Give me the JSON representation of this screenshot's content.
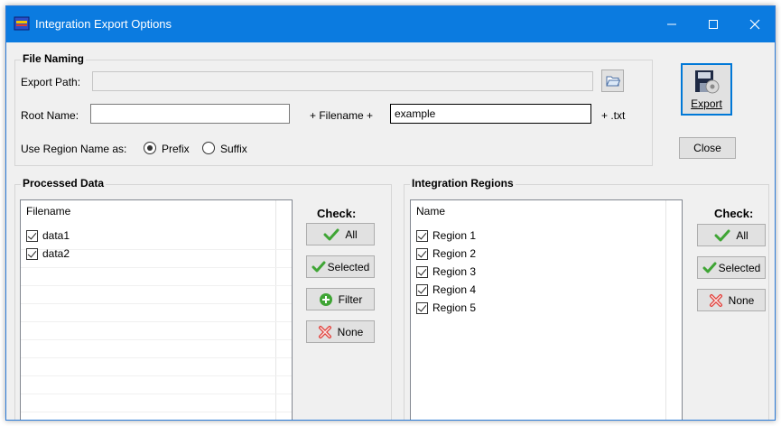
{
  "window": {
    "title": "Integration Export Options"
  },
  "file_naming": {
    "title": "File Naming",
    "export_path_label": "Export Path:",
    "export_path_value": "",
    "root_name_label": "Root Name:",
    "root_name_value": "",
    "filename_joiner": "+ Filename +",
    "filename_example": "example",
    "extension": "+ .txt",
    "region_label": "Use Region Name as:",
    "prefix_label": "Prefix",
    "suffix_label": "Suffix",
    "selected_position": "Prefix"
  },
  "actions": {
    "export_label": "Export",
    "close_label": "Close"
  },
  "processed_data": {
    "title": "Processed Data",
    "column_header": "Filename",
    "items": [
      {
        "label": "data1",
        "checked": true
      },
      {
        "label": "data2",
        "checked": true
      }
    ],
    "check_label": "Check:",
    "buttons": {
      "all": "All",
      "selected": "Selected",
      "filter": "Filter",
      "none": "None"
    }
  },
  "integration_regions": {
    "title": "Integration Regions",
    "column_header": "Name",
    "items": [
      {
        "label": "Region 1",
        "checked": true
      },
      {
        "label": "Region 2",
        "checked": true
      },
      {
        "label": "Region 3",
        "checked": true
      },
      {
        "label": "Region 4",
        "checked": true
      },
      {
        "label": "Region 5",
        "checked": true
      }
    ],
    "check_label": "Check:",
    "buttons": {
      "all": "All",
      "selected": "Selected",
      "none": "None"
    }
  },
  "colors": {
    "titlebar": "#0b7be0",
    "check_green": "#3fa535",
    "none_red": "#e0403b",
    "accent": "#0078d7"
  }
}
